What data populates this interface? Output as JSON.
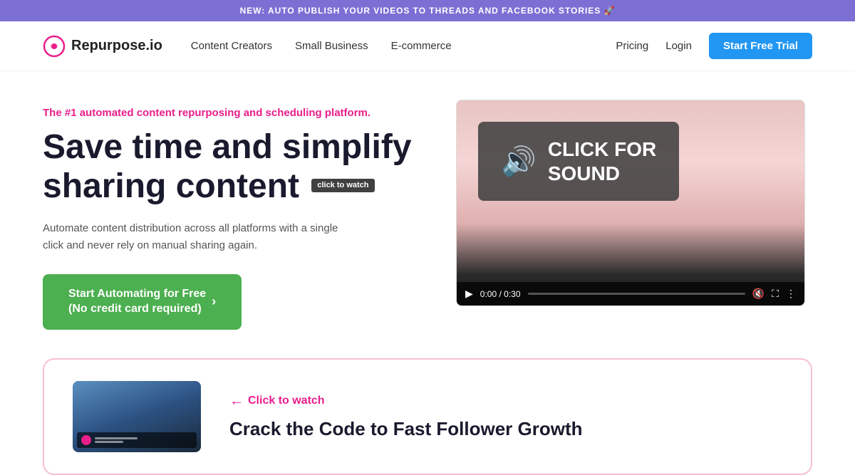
{
  "announcement": {
    "text": "NEW: AUTO PUBLISH YOUR VIDEOS TO THREADS AND FACEBOOK STORIES 🚀"
  },
  "nav": {
    "logo_text": "Repurpose.io",
    "links": [
      {
        "label": "Content Creators",
        "id": "content-creators"
      },
      {
        "label": "Small Business",
        "id": "small-business"
      },
      {
        "label": "E-commerce",
        "id": "ecommerce"
      }
    ],
    "right_links": [
      {
        "label": "Pricing",
        "id": "pricing"
      },
      {
        "label": "Login",
        "id": "login"
      }
    ],
    "cta_label": "Start Free Trial"
  },
  "hero": {
    "tagline_before": "The ",
    "tagline_highlight": "#1",
    "tagline_after": " automated content repurposing and scheduling platform.",
    "title_line1": "Save time and simplify",
    "title_line2": "sharing content",
    "click_to_watch": "click to watch",
    "description": "Automate content distribution across all platforms with a single click and never rely on manual sharing again.",
    "cta_label_line1": "Start Automating for Free",
    "cta_label_line2": "(No credit card required)"
  },
  "video": {
    "sound_label_line1": "CLICK FOR",
    "sound_label_line2": "SOUND",
    "time": "0:00 / 0:30"
  },
  "bottom_card": {
    "click_to_watch": "Click to watch",
    "title": "Crack the Code to Fast Follower Growth"
  }
}
